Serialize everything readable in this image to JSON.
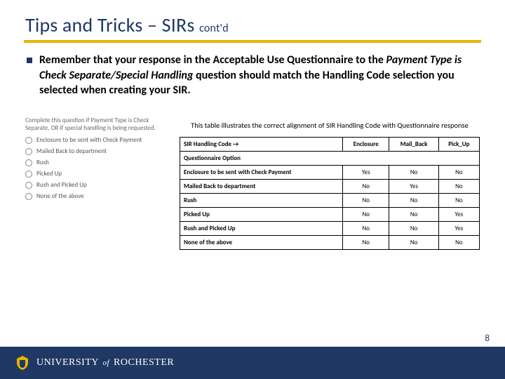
{
  "title": {
    "main": "Tips and Tricks – SIRs",
    "suffix": "cont'd"
  },
  "bullet": {
    "pre": "Remember that your response in the Acceptable Use Questionnaire to the ",
    "ital": "Payment Type is Check Separate/Special Handling",
    "post": " question should match the Handling Code selection you selected when creating your SIR."
  },
  "options": {
    "header": "Complete this question if Payment Type is Check Separate, OR if special handling is being requested.",
    "items": [
      "Enclosure to be sent with Check Payment",
      "Mailed Back to department",
      "Rush",
      "Picked Up",
      "Rush and Picked Up",
      "None of the above"
    ]
  },
  "caption": "This table illustrates the correct alignment of SIR Handling Code with Questionnaire response",
  "table": {
    "head_label": "SIR Handling Code →",
    "sub_label": "Questionnaire Option",
    "cols": [
      "Enclosure",
      "Mail_Back",
      "Pick_Up"
    ],
    "rows": [
      {
        "label": "Enclosure to be sent with Check Payment",
        "vals": [
          "Yes",
          "No",
          "No"
        ]
      },
      {
        "label": "Mailed Back to department",
        "vals": [
          "No",
          "Yes",
          "No"
        ]
      },
      {
        "label": "Rush",
        "vals": [
          "No",
          "No",
          "No"
        ]
      },
      {
        "label": "Picked Up",
        "vals": [
          "No",
          "No",
          "Yes"
        ]
      },
      {
        "label": "Rush and Picked Up",
        "vals": [
          "No",
          "No",
          "Yes"
        ]
      },
      {
        "label": "None of the above",
        "vals": [
          "No",
          "No",
          "No"
        ]
      }
    ]
  },
  "footer": {
    "univ1": "UNIVERSITY",
    "of": "of",
    "univ2": "ROCHESTER"
  },
  "page": "8",
  "chart_data": {
    "type": "table",
    "title": "SIR Handling Code vs Questionnaire response",
    "columns": [
      "Questionnaire Option",
      "Enclosure",
      "Mail_Back",
      "Pick_Up"
    ],
    "rows": [
      [
        "Enclosure to be sent with Check Payment",
        "Yes",
        "No",
        "No"
      ],
      [
        "Mailed Back to department",
        "No",
        "Yes",
        "No"
      ],
      [
        "Rush",
        "No",
        "No",
        "No"
      ],
      [
        "Picked Up",
        "No",
        "No",
        "Yes"
      ],
      [
        "Rush and Picked Up",
        "No",
        "No",
        "Yes"
      ],
      [
        "None of the above",
        "No",
        "No",
        "No"
      ]
    ]
  }
}
